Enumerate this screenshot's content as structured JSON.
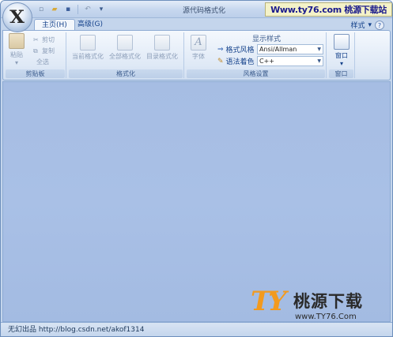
{
  "window": {
    "title": "源代码格式化"
  },
  "app_button": {
    "glyph": "X"
  },
  "quick_access": {
    "items": [
      {
        "icon": "new-doc-icon",
        "glyph": "▫"
      },
      {
        "icon": "open-folder-icon",
        "glyph": "▰"
      },
      {
        "icon": "save-icon",
        "glyph": "▪"
      },
      {
        "icon": "undo-icon",
        "glyph": "↶"
      },
      {
        "icon": "customize-dropdown-icon",
        "glyph": "▾"
      }
    ]
  },
  "banner": {
    "text": "Www.ty76.com 桃源下载站"
  },
  "tabs": [
    {
      "label": "主页(H)",
      "active": true
    },
    {
      "label": "高级(G)",
      "active": false
    }
  ],
  "style_menu": {
    "label": "样式",
    "help": "?"
  },
  "ribbon": {
    "clipboard": {
      "label": "剪贴板",
      "paste": "粘贴",
      "cut": "剪切",
      "copy": "复制",
      "select_all": "全选"
    },
    "format": {
      "label": "格式化",
      "current": "当前格式化",
      "all": "全部格式化",
      "directory": "目录格式化"
    },
    "style_settings": {
      "label": "风格设置",
      "font": "字体",
      "display_style": "显示样式",
      "format_style_label": "格式风格",
      "format_style_value": "Ansi/Allman",
      "syntax_color_label": "语法着色",
      "syntax_color_value": "C++"
    },
    "window_group": {
      "label": "窗口",
      "window": "窗口"
    }
  },
  "status": {
    "text": "无幻出品 http://blog.csdn.net/akof1314"
  },
  "watermark": {
    "logo": "TY",
    "name": "桃源下载",
    "url": "www.TY76.Com"
  },
  "colors": {
    "accent": "#15428b",
    "client_bg": "#a6bde3",
    "banner_bg": "#f4f2c8",
    "watermark_orange": "#f29a1f"
  }
}
